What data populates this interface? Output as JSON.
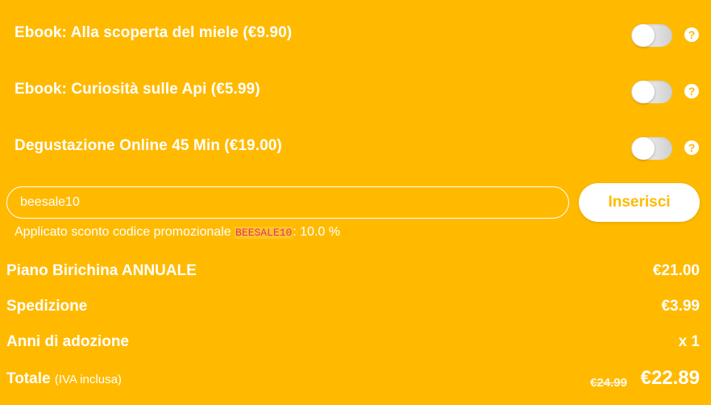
{
  "addons": [
    {
      "label": "Ebook: Alla scoperta del miele (€9.90)",
      "enabled": false
    },
    {
      "label": "Ebook: Curiosità sulle Api (€5.99)",
      "enabled": false
    },
    {
      "label": "Degustazione Online 45 Min (€19.00)",
      "enabled": false
    }
  ],
  "help_icon": {
    "glyph": "?",
    "icon": "question-mark-icon"
  },
  "promo": {
    "value": "beesale10",
    "placeholder": "",
    "button_label": "Inserisci",
    "applied_prefix": "Applicato sconto codice promozionale ",
    "applied_code": "BEESALE10",
    "applied_suffix": ": 10.0 %"
  },
  "summary": {
    "plan_label": "Piano Birichina ANNUALE",
    "plan_value": "€21.00",
    "shipping_label": "Spedizione",
    "shipping_value": "€3.99",
    "years_label": "Anni di adozione",
    "years_value": "x 1",
    "total_label": "Totale",
    "total_note": "(IVA inclusa)",
    "total_old": "€24.99",
    "total_value": "€22.89"
  },
  "colors": {
    "background": "#FFBA00",
    "text": "#ffffff",
    "code": "#e0306a"
  }
}
